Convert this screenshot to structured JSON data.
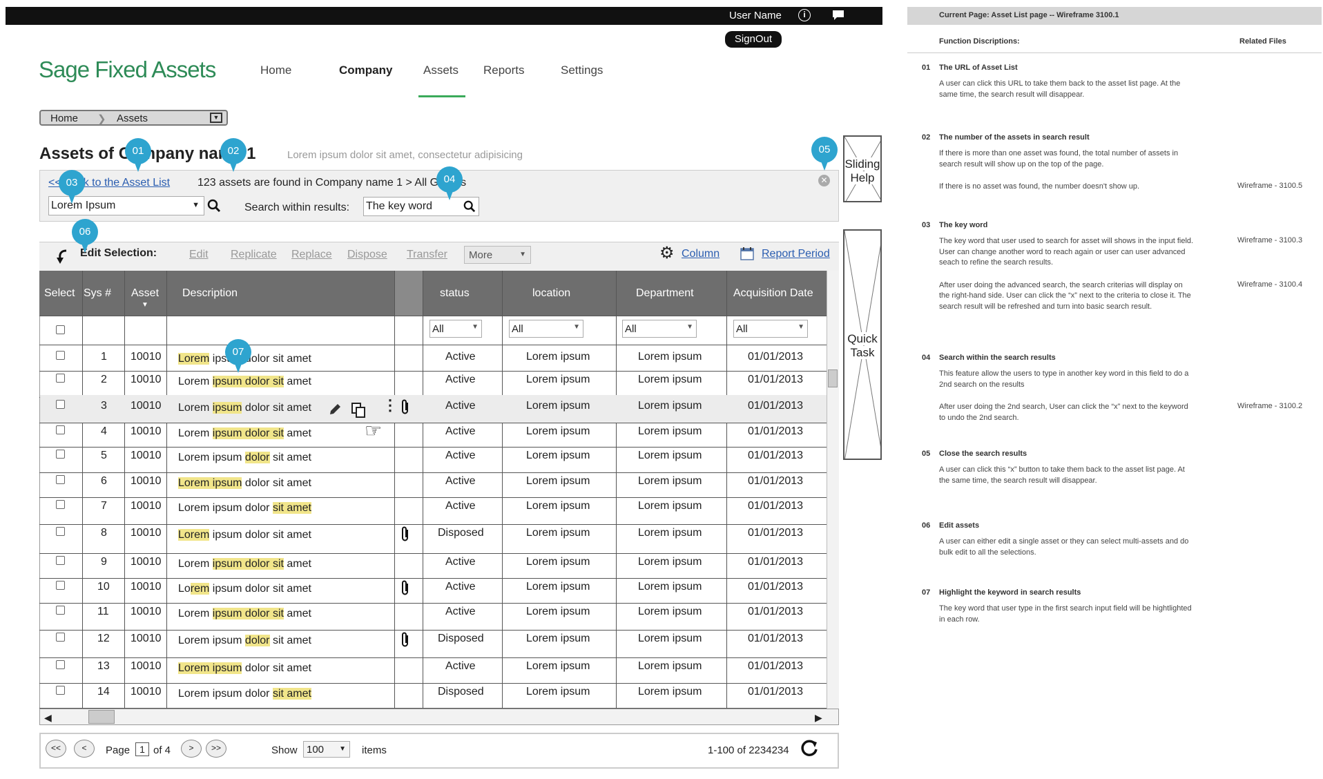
{
  "topbar": {
    "user_name": "User Name",
    "signout": "SignOut"
  },
  "logo": "Sage Fixed Assets",
  "nav": [
    "Home",
    "Company",
    "Assets",
    "Reports",
    "Settings"
  ],
  "breadcrumb": [
    "Home",
    "Assets"
  ],
  "page": {
    "title": "Assets of Company name 1",
    "subtitle": "Lorem ipsum dolor sit amet, consectetur adipisicing"
  },
  "search": {
    "back_link": "<< Back to the Asset List",
    "found_text": "123 assets are found in Company name 1 > All Groups",
    "keyword": "Lorem Ipsum",
    "within_label": "Search within results:",
    "within_value": "The key word"
  },
  "side": {
    "sliding_help": "Sliding Help",
    "quick_task": "Quick Task"
  },
  "toolbar": {
    "edit_selection": "Edit Selection:",
    "actions": [
      "Edit",
      "Replicate",
      "Replace",
      "Dispose",
      "Transfer"
    ],
    "more": "More",
    "column": "Column",
    "report_period": "Report Period"
  },
  "table": {
    "headers": [
      "Select",
      "Sys #",
      "Asset",
      "Description",
      "status",
      "location",
      "Department",
      "Acquisition Date"
    ],
    "filters": [
      "All",
      "All",
      "All",
      "All"
    ],
    "rows": [
      {
        "sys": "1",
        "asset": "10010",
        "desc": [
          "Lorem",
          " ipsum dolor sit amet"
        ],
        "status": "Active",
        "location": "Lorem ipsum",
        "dept": "Lorem ipsum",
        "date": "01/01/2013"
      },
      {
        "sys": "2",
        "asset": "10010",
        "desc": [
          "Lorem ",
          "ipsum dolor sit",
          " amet"
        ],
        "status": "Active",
        "location": "Lorem ipsum",
        "dept": "Lorem ipsum",
        "date": "01/01/2013"
      },
      {
        "sys": "3",
        "asset": "10010",
        "desc": [
          "Lorem ",
          "ipsum",
          " dolor sit amet"
        ],
        "status": "Active",
        "location": "Lorem ipsum",
        "dept": "Lorem ipsum",
        "date": "01/01/2013"
      },
      {
        "sys": "4",
        "asset": "10010",
        "desc": [
          "Lorem ",
          "ipsum dolor sit",
          " amet"
        ],
        "status": "Active",
        "location": "Lorem ipsum",
        "dept": "Lorem ipsum",
        "date": "01/01/2013"
      },
      {
        "sys": "5",
        "asset": "10010",
        "desc": [
          "Lorem ipsum ",
          "dolor",
          " sit amet"
        ],
        "status": "Active",
        "location": "Lorem ipsum",
        "dept": "Lorem ipsum",
        "date": "01/01/2013"
      },
      {
        "sys": "6",
        "asset": "10010",
        "desc": [
          "Lorem ipsum",
          " dolor sit amet"
        ],
        "status": "Active",
        "location": "Lorem ipsum",
        "dept": "Lorem ipsum",
        "date": "01/01/2013"
      },
      {
        "sys": "7",
        "asset": "10010",
        "desc": [
          "Lorem ipsum dolor ",
          "sit amet",
          ""
        ],
        "status": "Active",
        "location": "Lorem ipsum",
        "dept": "Lorem ipsum",
        "date": "01/01/2013"
      },
      {
        "sys": "8",
        "asset": "10010",
        "desc": [
          "Lorem",
          " ipsum dolor sit amet"
        ],
        "status": "Disposed",
        "location": "Lorem ipsum",
        "dept": "Lorem ipsum",
        "date": "01/01/2013"
      },
      {
        "sys": "9",
        "asset": "10010",
        "desc": [
          "Lorem ",
          "ipsum dolor sit",
          " amet"
        ],
        "status": "Active",
        "location": "Lorem ipsum",
        "dept": "Lorem ipsum",
        "date": "01/01/2013"
      },
      {
        "sys": "10",
        "asset": "10010",
        "desc": [
          "Lo",
          "rem",
          " ipsum dolor sit amet"
        ],
        "status": "Active",
        "location": "Lorem ipsum",
        "dept": "Lorem ipsum",
        "date": "01/01/2013"
      },
      {
        "sys": "11",
        "asset": "10010",
        "desc": [
          "Lorem ",
          "ipsum dolor sit",
          " amet"
        ],
        "status": "Active",
        "location": "Lorem ipsum",
        "dept": "Lorem ipsum",
        "date": "01/01/2013"
      },
      {
        "sys": "12",
        "asset": "10010",
        "desc": [
          "Lorem ipsum ",
          "dolor",
          " sit amet"
        ],
        "status": "Disposed",
        "location": "Lorem ipsum",
        "dept": "Lorem ipsum",
        "date": "01/01/2013"
      },
      {
        "sys": "13",
        "asset": "10010",
        "desc": [
          "Lorem ipsum",
          " dolor sit amet"
        ],
        "status": "Active",
        "location": "Lorem ipsum",
        "dept": "Lorem ipsum",
        "date": "01/01/2013"
      },
      {
        "sys": "14",
        "asset": "10010",
        "desc": [
          "Lorem ipsum dolor ",
          "sit amet",
          ""
        ],
        "status": "Disposed",
        "location": "Lorem ipsum",
        "dept": "Lorem ipsum",
        "date": "01/01/2013"
      }
    ]
  },
  "pager": {
    "first": "<<",
    "prev": "<",
    "page_label": "Page",
    "page_value": "1",
    "of_label": "of 4",
    "next": ">",
    "last": ">>",
    "show_label": "Show",
    "show_value": "100",
    "items_label": "items",
    "range": "1-100 of 2234234"
  },
  "callouts": [
    "01",
    "02",
    "03",
    "04",
    "05",
    "06",
    "07"
  ],
  "doc": {
    "current_page": "Current Page:  Asset List page -- Wireframe 3100.1",
    "functions_header": "Function Discriptions:",
    "related_header": "Related Files",
    "items": [
      {
        "num": "01",
        "title": "The URL of Asset List",
        "paras": [
          "A user can click this URL to take them back to the asset list page. At the same time, the search result will disappear."
        ],
        "related": [
          ""
        ]
      },
      {
        "num": "02",
        "title": "The number of the assets in search result",
        "paras": [
          "If there is more than one asset was found, the total number of assets in search result will show up on the top of the page.",
          "If there is no asset was found,  the number doesn't show up."
        ],
        "related": [
          "",
          "Wireframe - 3100.5"
        ]
      },
      {
        "num": "03",
        "title": "The key word",
        "paras": [
          "The key word that user used to search for asset will shows in the input field. User can change another word to reach again or user can user advanced seach to refine the search results.",
          "After user doing the advanced search, the search criterias will display on the right-hand side. User can click the “x” next to the criteria to close it. The search result will be refreshed and turn into basic search result."
        ],
        "related": [
          "Wireframe - 3100.3",
          "Wireframe - 3100.4"
        ]
      },
      {
        "num": "04",
        "title": "Search within the search results",
        "paras": [
          "This feature allow the users to type in another key word in this field to do a 2nd search on the results",
          "After user doing the 2nd search, User can click the “x” next to the keyword to undo the 2nd search."
        ],
        "related": [
          "",
          "Wireframe - 3100.2"
        ]
      },
      {
        "num": "05",
        "title": "Close the search results",
        "paras": [
          "A user can click this “x” button to take them back to the asset list page. At the same time, the search result will disappear."
        ],
        "related": [
          ""
        ]
      },
      {
        "num": "06",
        "title": "Edit assets",
        "paras": [
          "A user can either edit a single asset or they can select multi-assets and do bulk edit to all the selections."
        ],
        "related": [
          ""
        ]
      },
      {
        "num": "07",
        "title": "Highlight the keyword in search results",
        "paras": [
          "The key word that user type in the first search input field will be hightlighted in each row."
        ],
        "related": [
          ""
        ]
      }
    ]
  }
}
